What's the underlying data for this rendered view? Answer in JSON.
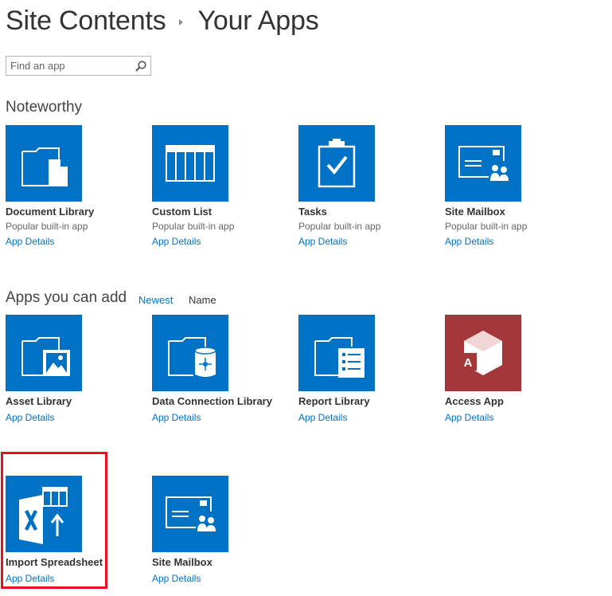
{
  "breadcrumb": {
    "root": "Site Contents",
    "current": "Your Apps"
  },
  "search": {
    "placeholder": "Find an app"
  },
  "noteworthy": {
    "title": "Noteworthy",
    "apps": [
      {
        "name": "Document Library",
        "subtitle": "Popular built-in app",
        "link": "App Details",
        "icon": "document-library-icon"
      },
      {
        "name": "Custom List",
        "subtitle": "Popular built-in app",
        "link": "App Details",
        "icon": "custom-list-icon"
      },
      {
        "name": "Tasks",
        "subtitle": "Popular built-in app",
        "link": "App Details",
        "icon": "tasks-clipboard-icon"
      },
      {
        "name": "Site Mailbox",
        "subtitle": "Popular built-in app",
        "link": "App Details",
        "icon": "site-mailbox-icon"
      }
    ]
  },
  "can_add": {
    "title": "Apps you can add",
    "sort": {
      "newest": "Newest",
      "name": "Name"
    },
    "apps": [
      {
        "name": "Asset Library",
        "link": "App Details",
        "icon": "asset-library-icon"
      },
      {
        "name": "Data Connection Library",
        "link": "App Details",
        "icon": "data-connection-library-icon"
      },
      {
        "name": "Report Library",
        "link": "App Details",
        "icon": "report-library-icon"
      },
      {
        "name": "Access App",
        "link": "App Details",
        "icon": "access-app-icon"
      },
      {
        "name": "Import Spreadsheet",
        "link": "App Details",
        "icon": "import-spreadsheet-icon"
      },
      {
        "name": "Site Mailbox",
        "link": "App Details",
        "icon": "site-mailbox-icon"
      }
    ]
  },
  "colors": {
    "tile_blue": "#0072c6",
    "tile_red": "#a4373a",
    "link": "#0072c6",
    "highlight": "#e81123"
  }
}
